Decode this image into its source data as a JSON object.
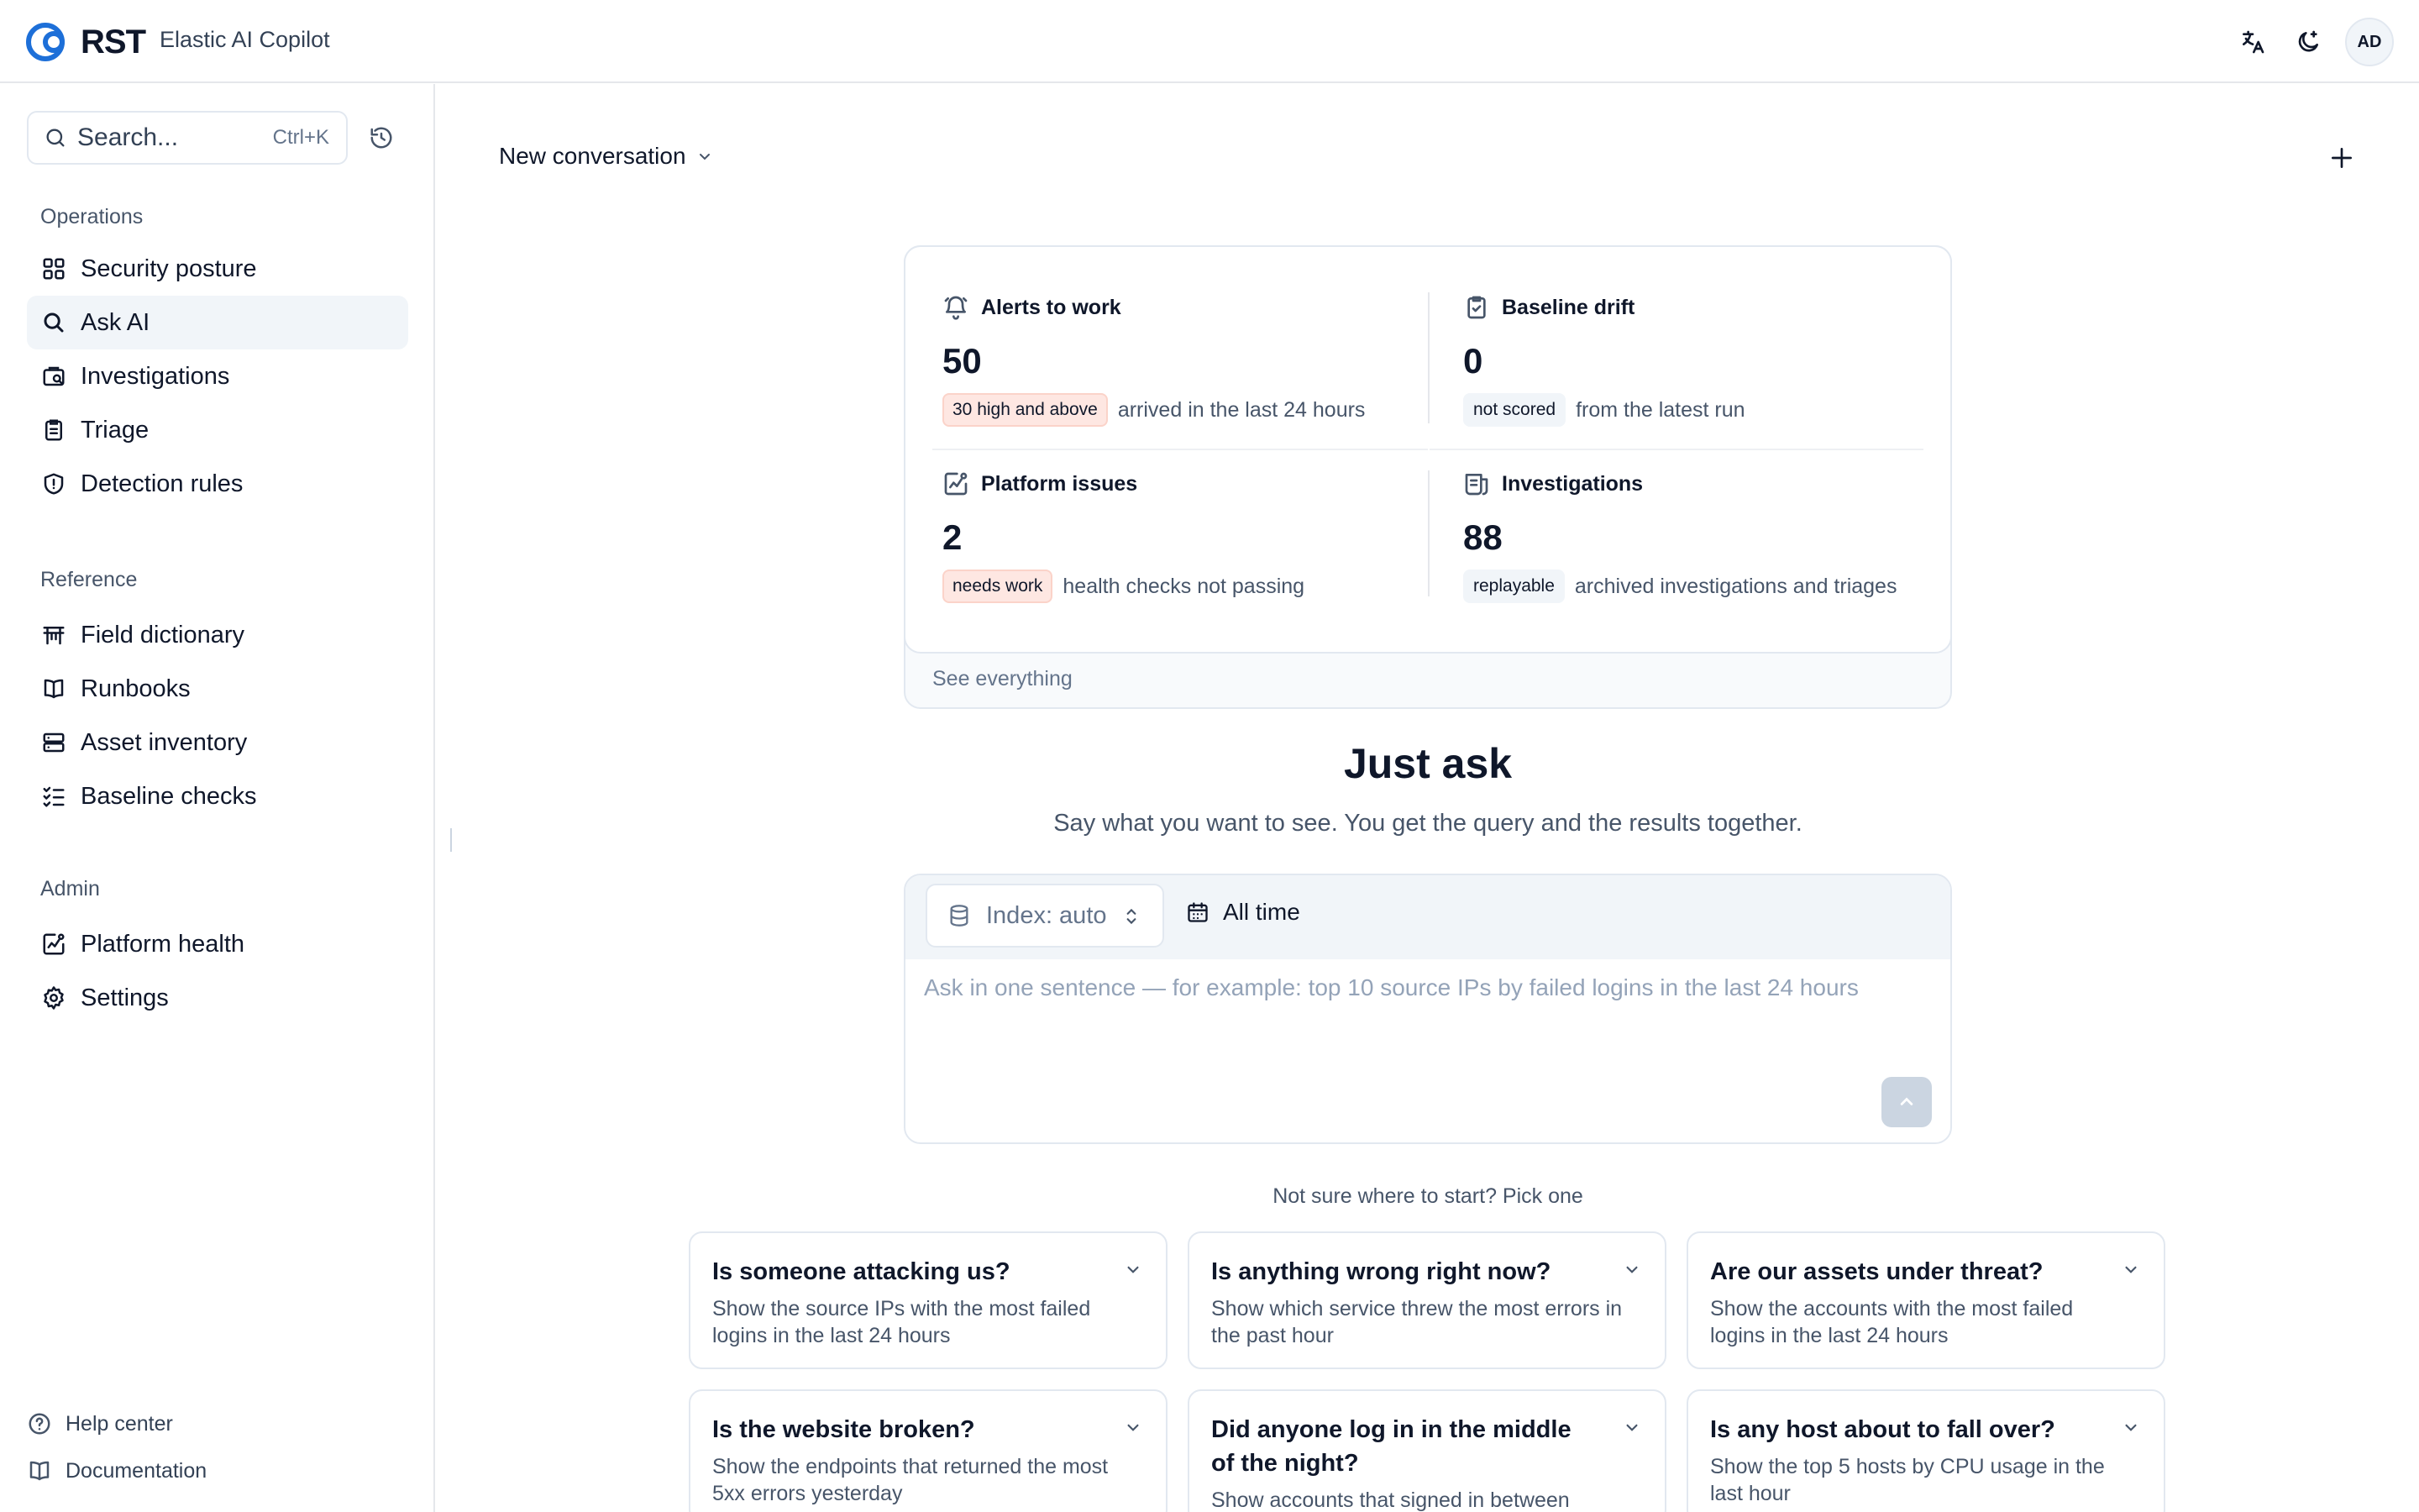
{
  "header": {
    "logo_text": "RST",
    "app_name": "Elastic AI Copilot",
    "avatar_initials": "AD",
    "icons": [
      "translate-icon",
      "theme-toggle-icon"
    ]
  },
  "sidebar": {
    "search_placeholder": "Search...",
    "search_shortcut": "Ctrl+K",
    "sections": [
      {
        "title": "Operations",
        "items": [
          {
            "label": "Security posture",
            "icon": "grid-icon"
          },
          {
            "label": "Ask AI",
            "icon": "search-icon",
            "active": true
          },
          {
            "label": "Investigations",
            "icon": "case-icon"
          },
          {
            "label": "Triage",
            "icon": "clipboard-icon"
          },
          {
            "label": "Detection rules",
            "icon": "shield-icon"
          }
        ]
      },
      {
        "title": "Reference",
        "items": [
          {
            "label": "Field dictionary",
            "icon": "table-icon"
          },
          {
            "label": "Runbooks",
            "icon": "book-icon"
          },
          {
            "label": "Asset inventory",
            "icon": "server-icon"
          },
          {
            "label": "Baseline checks",
            "icon": "checklist-icon"
          }
        ]
      },
      {
        "title": "Admin",
        "items": [
          {
            "label": "Platform health",
            "icon": "health-icon"
          },
          {
            "label": "Settings",
            "icon": "gear-icon"
          }
        ]
      }
    ],
    "footer": [
      {
        "label": "Help center",
        "icon": "help-icon"
      },
      {
        "label": "Documentation",
        "icon": "book-icon"
      }
    ]
  },
  "main": {
    "conversation_title": "New conversation",
    "stats": [
      {
        "title": "Alerts to work",
        "value": "50",
        "badge": "30 high and above",
        "badge_tone": "red",
        "desc": "arrived in the last 24 hours",
        "icon": "bell-icon"
      },
      {
        "title": "Baseline drift",
        "value": "0",
        "badge": "not scored",
        "badge_tone": "gray",
        "desc": "from the latest run",
        "icon": "clipboard-check-icon"
      },
      {
        "title": "Platform issues",
        "value": "2",
        "badge": "needs work",
        "badge_tone": "red",
        "desc": "health checks not passing",
        "icon": "health-icon"
      },
      {
        "title": "Investigations",
        "value": "88",
        "badge": "replayable",
        "badge_tone": "gray",
        "desc": "archived investigations and triages",
        "icon": "scroll-icon"
      }
    ],
    "see_everything": "See everything",
    "hero_title": "Just ask",
    "hero_subtitle": "Say what you want to see. You get the query and the results together.",
    "composer": {
      "index_label": "Index: auto",
      "time_label": "All time",
      "placeholder": "Ask in one sentence — for example: top 10 source IPs by failed logins in the last 24 hours"
    },
    "pick_title": "Not sure where to start? Pick one",
    "suggestions": [
      {
        "q": "Is someone attacking us?",
        "a": "Show the source IPs with the most failed logins in the last 24 hours"
      },
      {
        "q": "Is anything wrong right now?",
        "a": "Show which service threw the most errors in the past hour"
      },
      {
        "q": "Are our assets under threat?",
        "a": "Show the accounts with the most failed logins in the last 24 hours"
      },
      {
        "q": "Is the website broken?",
        "a": "Show the endpoints that returned the most 5xx errors yesterday"
      },
      {
        "q": "Did anyone log in in the middle of the night?",
        "a": "Show accounts that signed in between"
      },
      {
        "q": "Is any host about to fall over?",
        "a": "Show the top 5 hosts by CPU usage in the last hour"
      }
    ]
  }
}
